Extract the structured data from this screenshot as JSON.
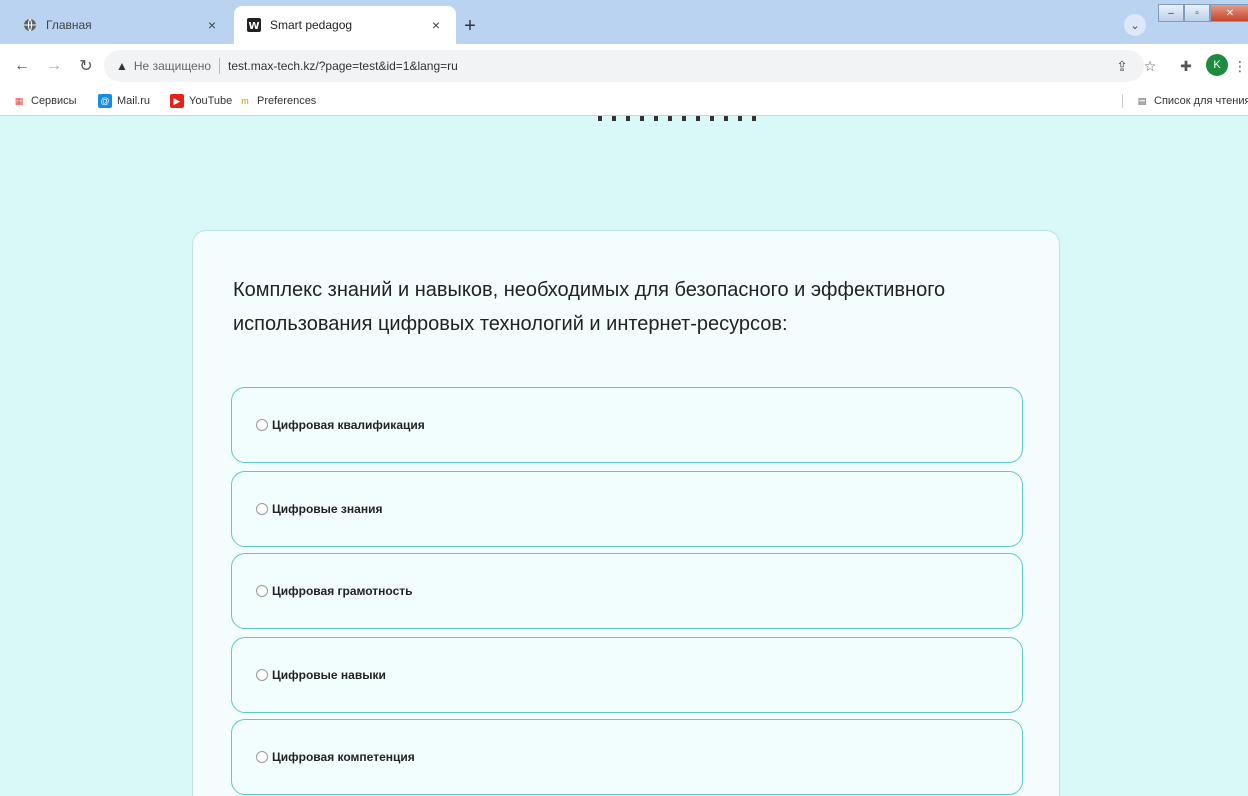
{
  "browser": {
    "tabs": [
      {
        "title": "Главная",
        "favicon": "globe-icon"
      },
      {
        "title": "Smart pedagog",
        "favicon": "w-icon"
      }
    ],
    "new_tab": "+",
    "tab_close": "×",
    "address": {
      "warning_icon": "▲",
      "security_label": "Не защищено",
      "url": "test.max-tech.kz/?page=test&id=1&lang=ru"
    },
    "profile_initial": "K",
    "bookmarks": [
      {
        "label": "Сервисы"
      },
      {
        "label": "Mail.ru"
      },
      {
        "label": "YouTube"
      },
      {
        "label": "Preferences"
      }
    ],
    "reading_list": "Список для чтения"
  },
  "quiz": {
    "question": "Комплекс знаний и навыков, необходимых для безопасного и эффективного использования цифровых технологий и интернет-ресурсов:",
    "options": [
      {
        "label": "Цифровая квалификация"
      },
      {
        "label": "Цифровые знания"
      },
      {
        "label": "Цифровая грамотность"
      },
      {
        "label": "Цифровые навыки"
      },
      {
        "label": "Цифровая компетенция"
      }
    ]
  }
}
